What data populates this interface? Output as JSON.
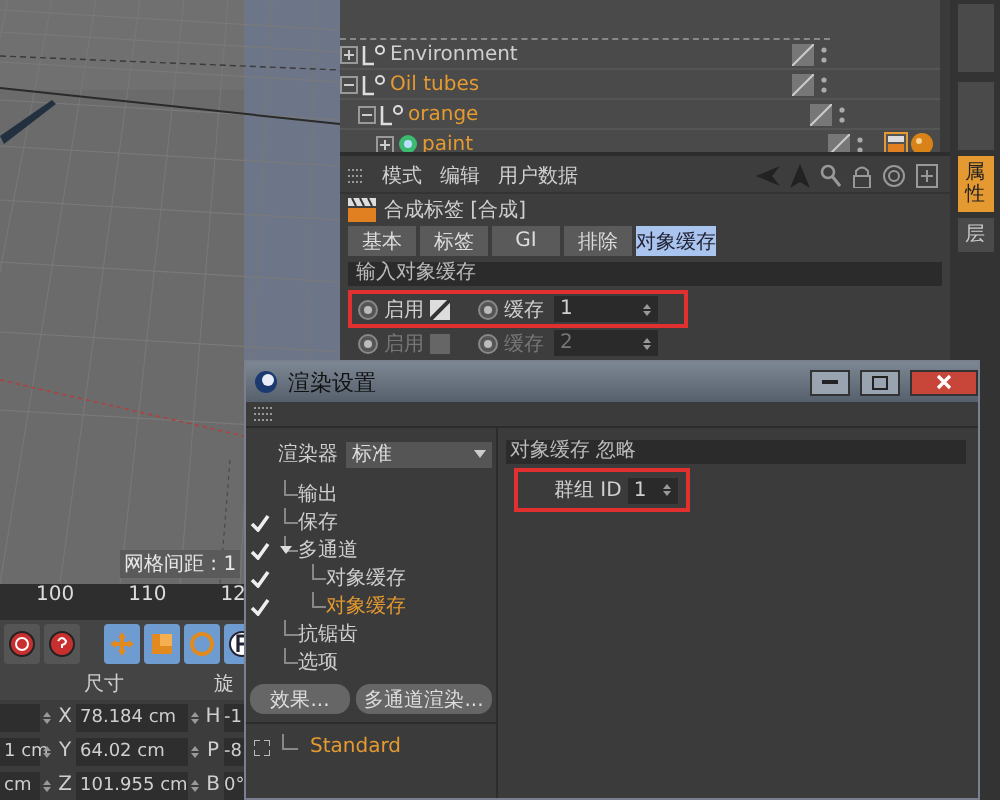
{
  "viewport": {
    "grid_label": "网格间距 : 1"
  },
  "objects": [
    {
      "name": "Environment",
      "kind": "null",
      "expanded": false,
      "selected": false
    },
    {
      "name": "Oil tubes",
      "kind": "null",
      "expanded": true,
      "selected": true,
      "children": [
        {
          "name": "orange",
          "kind": "null",
          "expanded": true,
          "selected": true,
          "children": [
            {
              "name": "paint",
              "kind": "polygon",
              "expanded": false,
              "selected": true,
              "tags": [
                {
                  "kind": "compositing"
                },
                {
                  "kind": "material"
                }
              ]
            }
          ]
        }
      ]
    }
  ],
  "attributes": {
    "menu": [
      "模式",
      "编辑",
      "用户数据"
    ],
    "title": "合成标签 [合成]",
    "tabs": [
      {
        "label": "基本",
        "selected": false
      },
      {
        "label": "标签",
        "selected": false
      },
      {
        "label": "GI",
        "selected": false
      },
      {
        "label": "排除",
        "selected": false
      },
      {
        "label": "对象缓存",
        "selected": true
      }
    ],
    "section": "输入对象缓存",
    "rows": [
      {
        "enable_label": "启用",
        "checked": true,
        "disabled": false,
        "cache_label": "缓存",
        "value": "1",
        "highlighted": true
      },
      {
        "enable_label": "启用",
        "checked": false,
        "disabled": true,
        "cache_label": "缓存",
        "value": "2"
      }
    ]
  },
  "side_tabs": [
    {
      "label": "属性",
      "selected": true
    },
    {
      "label": "层",
      "selected": false
    }
  ],
  "timeline": {
    "ruler": [
      "100",
      "110",
      "12"
    ]
  },
  "coordinates": {
    "size_header": "尺寸",
    "rotation_header": "旋",
    "rows": [
      {
        "axis": "X",
        "size": "78.184 cm",
        "rot_axis": "H",
        "rotation": "-1"
      },
      {
        "position": "1 cm",
        "axis": "Y",
        "size": "64.02 cm",
        "rot_axis": "P",
        "rotation": "-8"
      },
      {
        "position": "cm",
        "axis": "Z",
        "size": "101.955 cm",
        "rot_axis": "B",
        "rotation": "0°"
      }
    ]
  },
  "dialog": {
    "title": "渲染设置",
    "renderer_label": "渲染器",
    "renderer": "标准",
    "tree": [
      {
        "label": "输出",
        "checked": false,
        "selected": false
      },
      {
        "label": "保存",
        "checked": true,
        "selected": false
      },
      {
        "label": "多通道",
        "checked": true,
        "selected": false,
        "expanded": true,
        "children": [
          {
            "label": "对象缓存",
            "checked": true,
            "selected": false
          },
          {
            "label": "对象缓存",
            "checked": true,
            "selected": true
          }
        ]
      },
      {
        "label": "抗锯齿",
        "checked": false,
        "selected": false
      },
      {
        "label": "选项",
        "checked": false,
        "selected": false
      }
    ],
    "buttons": [
      "效果...",
      "多通道渲染..."
    ],
    "settings": [
      {
        "label": "Standard",
        "selected": true
      }
    ],
    "section": "对象缓存 忽略",
    "field_label": "群组 ID",
    "field_value": "1",
    "highlighted": true
  }
}
